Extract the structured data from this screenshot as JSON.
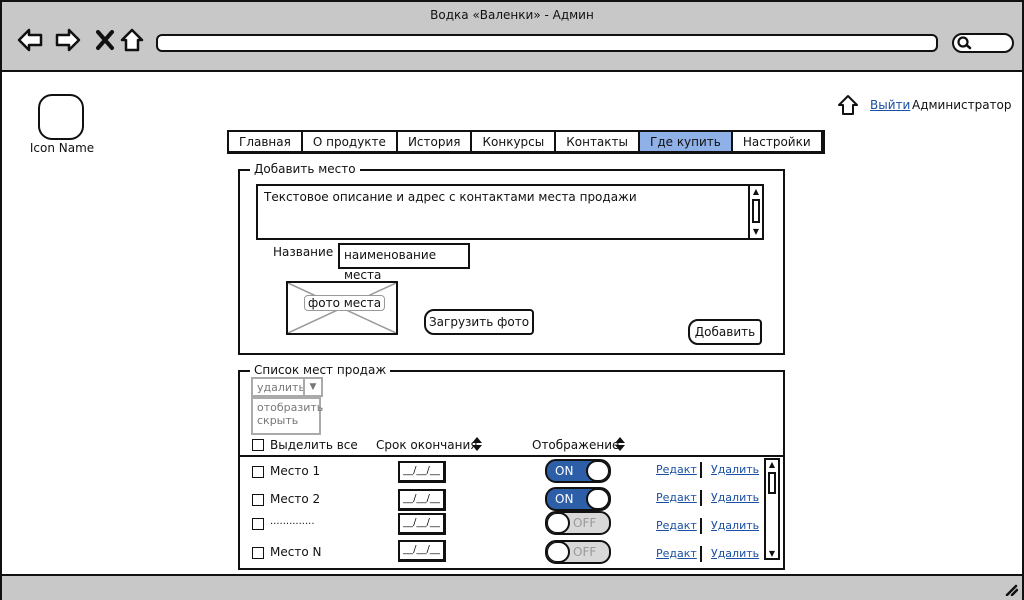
{
  "window": {
    "title": "Водка «Валенки» - Админ"
  },
  "logo": {
    "label": "Icon Name"
  },
  "user": {
    "logout_label": "Выйти",
    "role": "Администратор"
  },
  "tabs": [
    {
      "label": "Главная",
      "active": false
    },
    {
      "label": "О продукте",
      "active": false
    },
    {
      "label": "История",
      "active": false
    },
    {
      "label": "Конкурсы",
      "active": false
    },
    {
      "label": "Контакты",
      "active": false
    },
    {
      "label": "Где купить",
      "active": true
    },
    {
      "label": "Настройки",
      "active": false
    }
  ],
  "add_place": {
    "legend": "Добавить место",
    "description": "Текстовое описание и адрес с контактами места продажи",
    "name_label": "Название",
    "name_value": "наименование места",
    "photo_caption": "фото места",
    "upload_label": "Загрузить фото",
    "add_label": "Добавить"
  },
  "places_list": {
    "legend": "Список мест продаж",
    "action_select": "удалить",
    "display_options": [
      "отобразить",
      "скрыть"
    ],
    "select_all_label": "Выделить все",
    "col_expiry": "Срок окончания",
    "col_display": "Отображение",
    "rows": [
      {
        "name": "Место 1",
        "date": "__/__/__",
        "state": "ON",
        "on": true,
        "edit": "Редакт",
        "delete": "Удалить"
      },
      {
        "name": "Место 2",
        "date": "__/__/__",
        "state": "ON",
        "on": true,
        "edit": "Редакт",
        "delete": "Удалить"
      },
      {
        "name": "..............",
        "date": "__/__/__",
        "state": "OFF",
        "on": false,
        "edit": "Редакт",
        "delete": "Удалить"
      },
      {
        "name": "Место N",
        "date": "__/__/__",
        "state": "OFF",
        "on": false,
        "edit": "Редакт",
        "delete": "Удалить"
      }
    ]
  },
  "colors": {
    "chrome": "#c8c8c8",
    "accent": "#8fb1e8",
    "toggle_on": "#2d5ea8",
    "link": "#1a4fa3"
  }
}
